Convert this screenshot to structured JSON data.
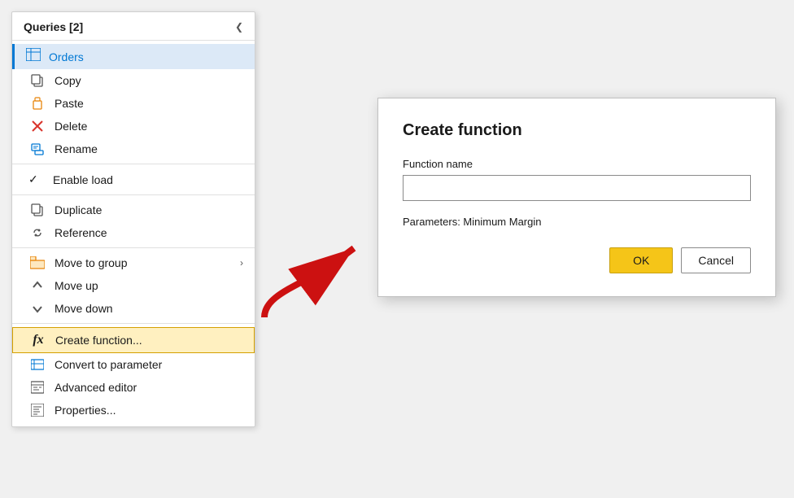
{
  "header": {
    "title": "Queries [2]",
    "collapse_icon": "❮"
  },
  "selected_item": {
    "label": "Orders",
    "icon": "table"
  },
  "menu_items": [
    {
      "id": "copy",
      "label": "Copy",
      "icon": "copy",
      "type": "item"
    },
    {
      "id": "paste",
      "label": "Paste",
      "icon": "paste",
      "type": "item"
    },
    {
      "id": "delete",
      "label": "Delete",
      "icon": "delete",
      "type": "item"
    },
    {
      "id": "rename",
      "label": "Rename",
      "icon": "rename",
      "type": "item"
    },
    {
      "id": "divider1",
      "type": "divider"
    },
    {
      "id": "enable-load",
      "label": "Enable load",
      "icon": "check",
      "type": "checkitem",
      "checked": true
    },
    {
      "id": "divider2",
      "type": "divider"
    },
    {
      "id": "duplicate",
      "label": "Duplicate",
      "icon": "duplicate",
      "type": "item"
    },
    {
      "id": "reference",
      "label": "Reference",
      "icon": "reference",
      "type": "item"
    },
    {
      "id": "divider3",
      "type": "divider"
    },
    {
      "id": "move-to-group",
      "label": "Move to group",
      "icon": "move-group",
      "type": "item",
      "has_arrow": true
    },
    {
      "id": "move-up",
      "label": "Move up",
      "icon": "move-up",
      "type": "item"
    },
    {
      "id": "move-down",
      "label": "Move down",
      "icon": "move-down",
      "type": "item"
    },
    {
      "id": "divider4",
      "type": "divider"
    },
    {
      "id": "create-function",
      "label": "Create function...",
      "icon": "fx",
      "type": "item",
      "highlighted": true
    },
    {
      "id": "convert-to-param",
      "label": "Convert to parameter",
      "icon": "convert",
      "type": "item"
    },
    {
      "id": "advanced-editor",
      "label": "Advanced editor",
      "icon": "advanced",
      "type": "item"
    },
    {
      "id": "properties",
      "label": "Properties...",
      "icon": "properties",
      "type": "item"
    }
  ],
  "dialog": {
    "title": "Create function",
    "field_label": "Function name",
    "field_placeholder": "",
    "params_label": "Parameters: Minimum Margin",
    "ok_label": "OK",
    "cancel_label": "Cancel"
  }
}
